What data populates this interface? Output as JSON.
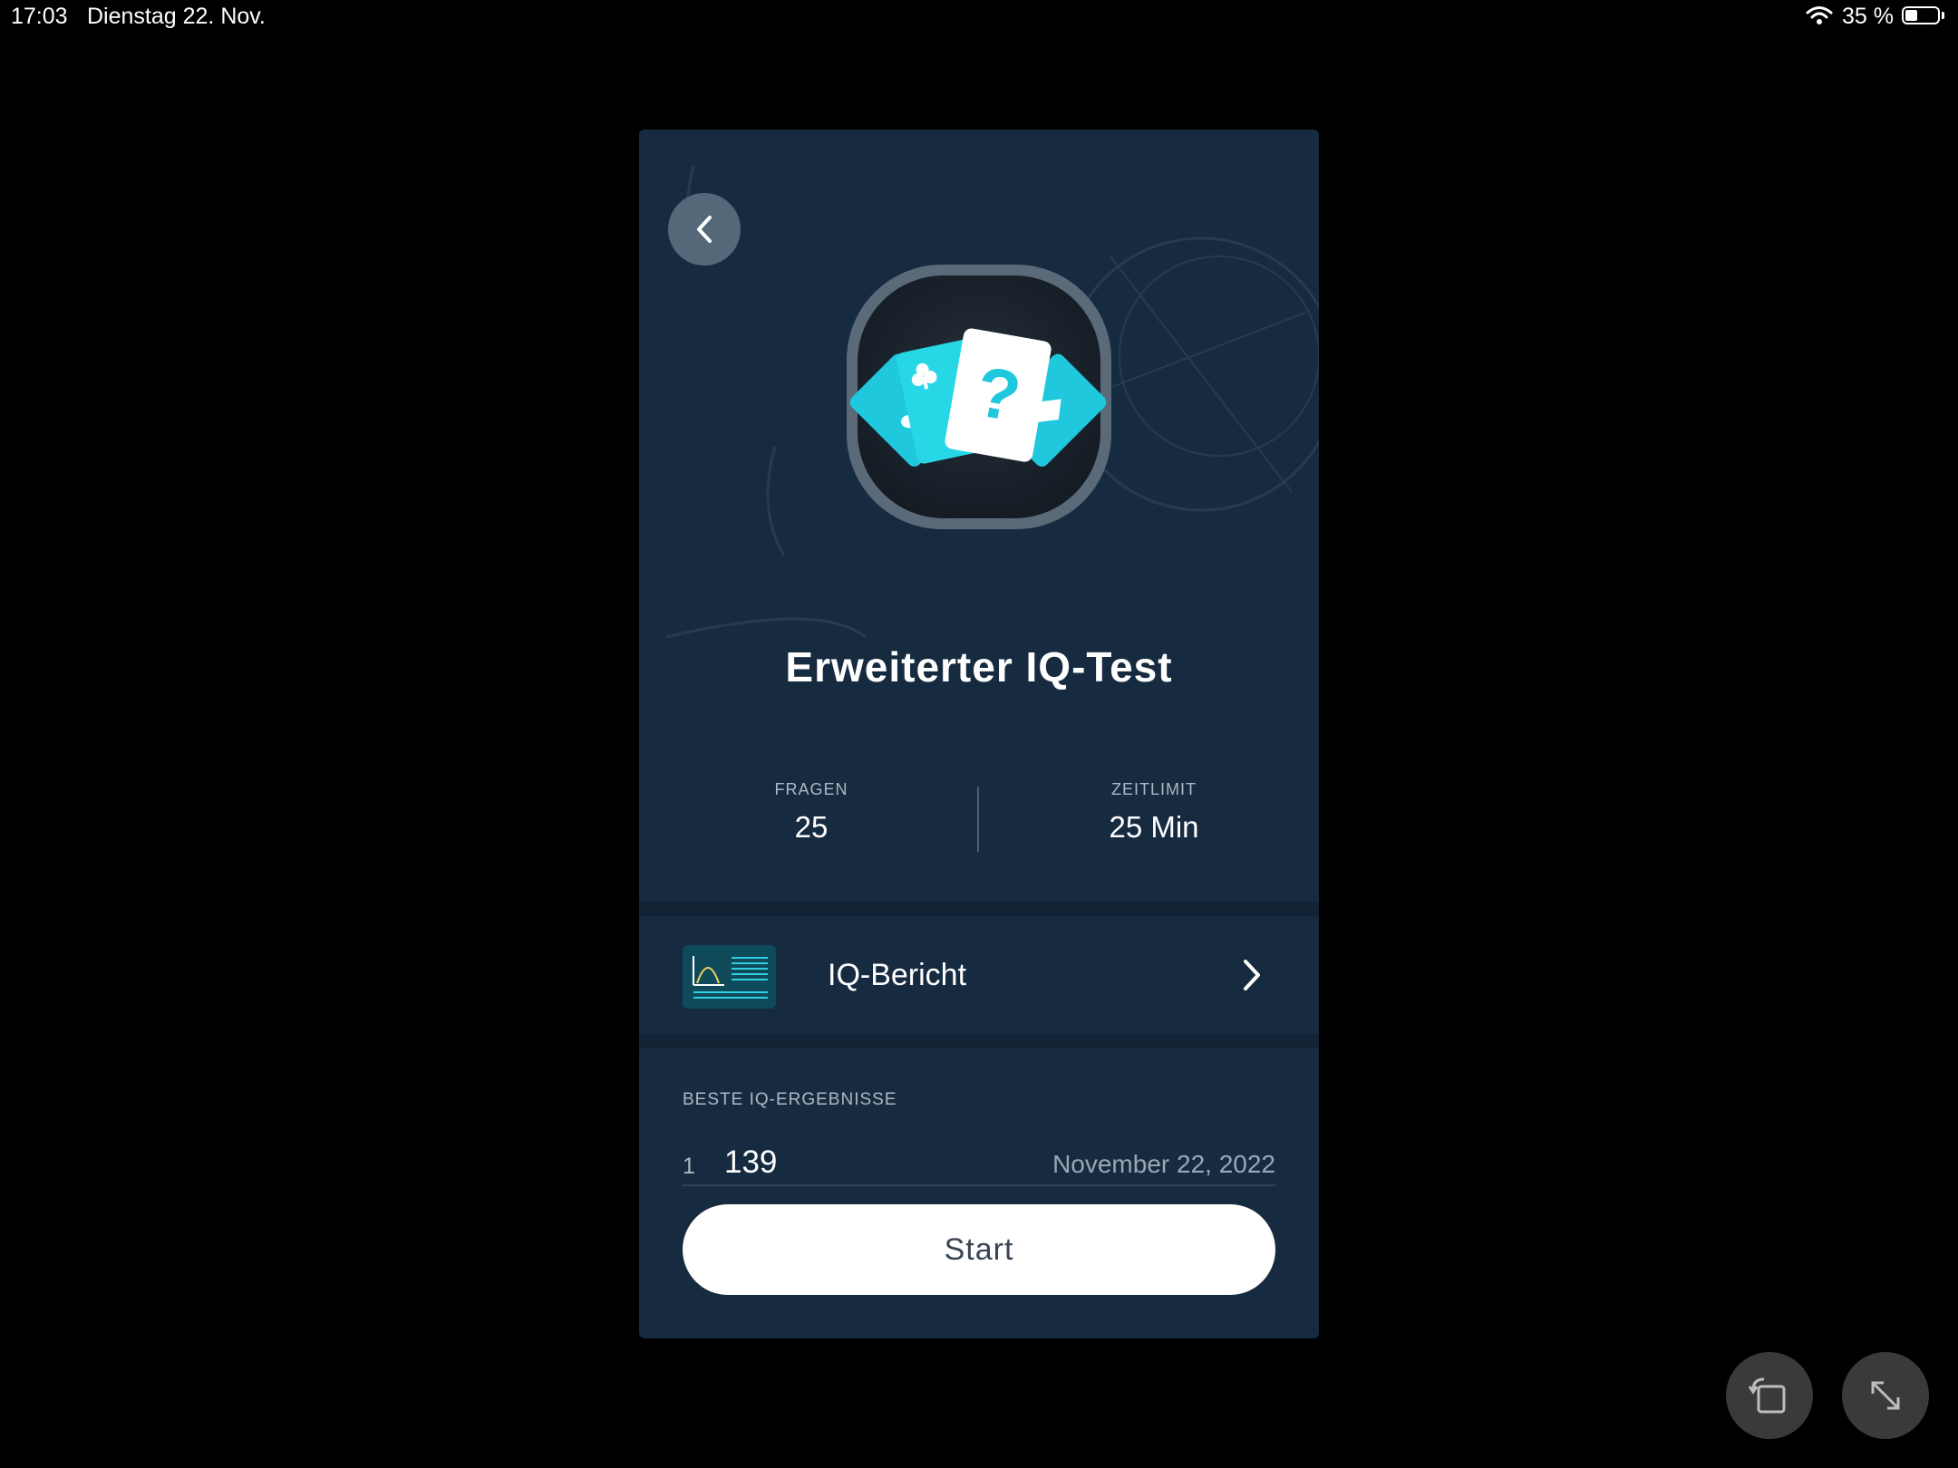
{
  "status_bar": {
    "time": "17:03",
    "date": "Dienstag 22. Nov.",
    "battery_percent": "35 %",
    "battery_level": 0.35
  },
  "test": {
    "title": "Erweiterter IQ-Test",
    "questions_label": "FRAGEN",
    "questions_value": "25",
    "timelimit_label": "ZEITLIMIT",
    "timelimit_value": "25 Min"
  },
  "report": {
    "label": "IQ-Bericht"
  },
  "results": {
    "label": "BESTE IQ-ERGEBNISSE",
    "rows": [
      {
        "rank": "1",
        "score": "139",
        "date": "November 22, 2022"
      }
    ]
  },
  "start_button": "Start",
  "icons": {
    "back": "chevron-left-icon",
    "report_chevron": "chevron-right-icon",
    "rotate": "rotate-screen-icon",
    "fullscreen": "expand-icon"
  },
  "colors": {
    "card_bg": "#172b40",
    "accent_cyan": "#1fd2e0",
    "start_bg": "#ffffff"
  }
}
